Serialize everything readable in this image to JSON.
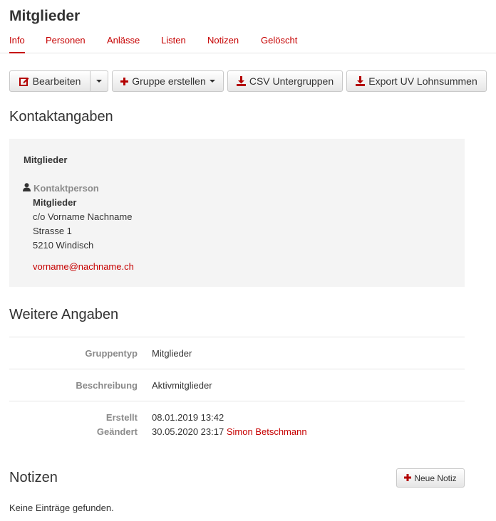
{
  "page": {
    "title": "Mitglieder"
  },
  "tabs": [
    {
      "label": "Info",
      "active": true
    },
    {
      "label": "Personen",
      "active": false
    },
    {
      "label": "Anlässe",
      "active": false
    },
    {
      "label": "Listen",
      "active": false
    },
    {
      "label": "Notizen",
      "active": false
    },
    {
      "label": "Gelöscht",
      "active": false
    }
  ],
  "toolbar": {
    "edit_label": "Bearbeiten",
    "create_group_label": "Gruppe erstellen",
    "csv_label": "CSV Untergruppen",
    "export_label": "Export UV Lohnsummen"
  },
  "contact": {
    "heading": "Kontaktangaben",
    "box_title": "Mitglieder",
    "person_label": "Kontaktperson",
    "name": "Mitglieder",
    "co_line": "c/o Vorname Nachname",
    "street": "Strasse 1",
    "city": "5210 Windisch",
    "email": "vorname@nachname.ch"
  },
  "details": {
    "heading": "Weitere Angaben",
    "rows": [
      {
        "label": "Gruppentyp",
        "value": "Mitglieder"
      },
      {
        "label": "Beschreibung",
        "value": "Aktivmitglieder"
      }
    ],
    "created_label": "Erstellt",
    "created_value": "08.01.2019 13:42",
    "changed_label": "Geändert",
    "changed_value": "30.05.2020 23:17",
    "changed_by": "Simon Betschmann"
  },
  "notes": {
    "heading": "Notizen",
    "new_note_label": "Neue Notiz",
    "empty_text": "Keine Einträge gefunden."
  },
  "colors": {
    "accent": "#c60000",
    "muted": "#8a8a8a",
    "panel": "#f4f4f4"
  }
}
